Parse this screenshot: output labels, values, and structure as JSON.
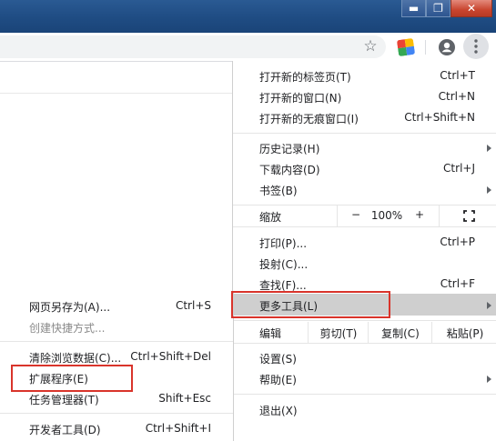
{
  "window": {
    "buttons": {
      "minimize_glyph": "▬",
      "maximize_glyph": "❐",
      "close_glyph": "✕"
    }
  },
  "toolbar": {
    "bookmark_glyph": "☆",
    "extension_colors": [
      "#ea4335",
      "#fbbc04",
      "#34a853",
      "#4285f4"
    ]
  },
  "main_menu": {
    "group1": [
      {
        "label": "打开新的标签页(T)",
        "shortcut": "Ctrl+T"
      },
      {
        "label": "打开新的窗口(N)",
        "shortcut": "Ctrl+N"
      },
      {
        "label": "打开新的无痕窗口(I)",
        "shortcut": "Ctrl+Shift+N"
      }
    ],
    "group2": [
      {
        "label": "历史记录(H)",
        "shortcut": "",
        "submenu": true
      },
      {
        "label": "下载内容(D)",
        "shortcut": "Ctrl+J"
      },
      {
        "label": "书签(B)",
        "shortcut": "",
        "submenu": true
      }
    ],
    "zoom": {
      "label": "缩放",
      "minus": "−",
      "value": "100%",
      "plus": "+"
    },
    "group3": [
      {
        "label": "打印(P)...",
        "shortcut": "Ctrl+P"
      },
      {
        "label": "投射(C)...",
        "shortcut": ""
      },
      {
        "label": "查找(F)...",
        "shortcut": "Ctrl+F"
      },
      {
        "label": "更多工具(L)",
        "shortcut": "",
        "submenu": true,
        "highlighted": true
      }
    ],
    "edit": {
      "label": "编辑",
      "cut": "剪切(T)",
      "copy": "复制(C)",
      "paste": "粘贴(P)"
    },
    "group4": [
      {
        "label": "设置(S)",
        "shortcut": ""
      },
      {
        "label": "帮助(E)",
        "shortcut": "",
        "submenu": true
      }
    ],
    "exit": {
      "label": "退出(X)"
    }
  },
  "more_tools_menu": {
    "items": [
      {
        "label": "网页另存为(A)...",
        "shortcut": "Ctrl+S"
      },
      {
        "label": "创建快捷方式...",
        "shortcut": "",
        "disabled": true
      },
      {
        "label": "清除浏览数据(C)...",
        "shortcut": "Ctrl+Shift+Del"
      },
      {
        "label": "扩展程序(E)",
        "shortcut": ""
      },
      {
        "label": "任务管理器(T)",
        "shortcut": "Shift+Esc"
      },
      {
        "label": "开发者工具(D)",
        "shortcut": "Ctrl+Shift+I"
      }
    ]
  },
  "annotations": {
    "highlight_color": "#d9342b"
  }
}
